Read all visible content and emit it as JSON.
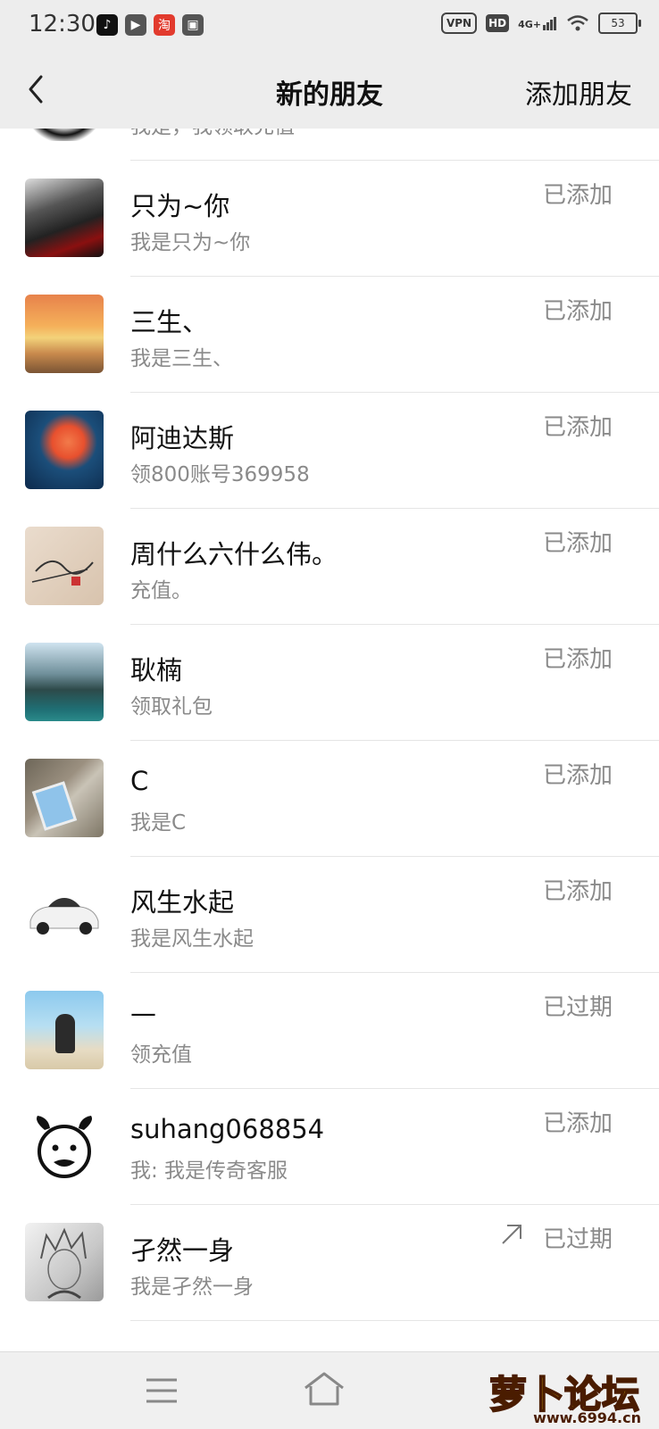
{
  "status_bar": {
    "time": "12:30",
    "vpn": "VPN",
    "hd": "HD",
    "network": "4G+",
    "battery": "53",
    "app_icons": [
      "tiktok-icon",
      "player-icon",
      "taobao-icon",
      "gallery-icon"
    ]
  },
  "header": {
    "title": "新的朋友",
    "action": "添加朋友",
    "back_icon": "chevron-left-icon"
  },
  "partial_row": {
    "msg": "我是，我领取充值"
  },
  "friends": [
    {
      "name": "只为~你",
      "msg": "我是只为~你",
      "status": "已添加"
    },
    {
      "name": "三生、",
      "msg": "我是三生、",
      "status": "已添加"
    },
    {
      "name": "阿迪达斯",
      "msg": "领800账号369958",
      "status": "已添加"
    },
    {
      "name": "周什么六什么伟。",
      "msg": "充值。",
      "status": "已添加"
    },
    {
      "name": "耿楠",
      "msg": "领取礼包",
      "status": "已添加"
    },
    {
      "name": "C",
      "msg": "我是C",
      "status": "已添加"
    },
    {
      "name": "风生水起",
      "msg": "我是风生水起",
      "status": "已添加"
    },
    {
      "name": "—",
      "msg": "领充值",
      "status": "已过期"
    },
    {
      "name": "suhang068854",
      "msg": "我: 我是传奇客服",
      "status": "已添加"
    },
    {
      "name": "孑然一身",
      "msg": "我是孑然一身",
      "status": "已过期"
    }
  ],
  "bottom_nav": {
    "menu_icon": "menu-icon",
    "home_icon": "home-icon"
  },
  "watermark": {
    "text": "萝卜论坛",
    "url": "www.6994.cn"
  }
}
